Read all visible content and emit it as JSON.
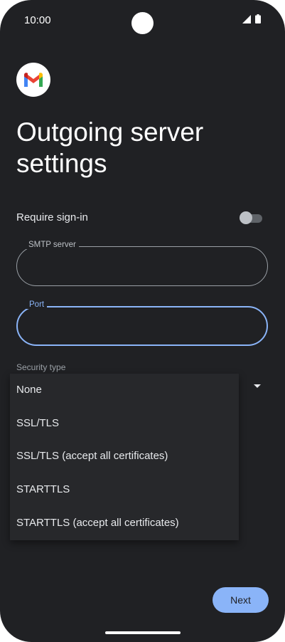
{
  "status_bar": {
    "time": "10:00"
  },
  "app": {
    "logo_icon": "gmail-logo-icon"
  },
  "page": {
    "title": "Outgoing server settings"
  },
  "require_signin": {
    "label": "Require sign-in",
    "enabled": false
  },
  "smtp_server": {
    "label": "SMTP server",
    "value": ""
  },
  "port": {
    "label": "Port",
    "value": ""
  },
  "security_type": {
    "label": "Security type",
    "options": [
      "None",
      "SSL/TLS",
      "SSL/TLS (accept all certificates)",
      "STARTTLS",
      "STARTTLS (accept all certificates)"
    ]
  },
  "actions": {
    "next_label": "Next"
  },
  "colors": {
    "background": "#202124",
    "accent": "#8ab4f8",
    "menu_surface": "#27282b"
  }
}
